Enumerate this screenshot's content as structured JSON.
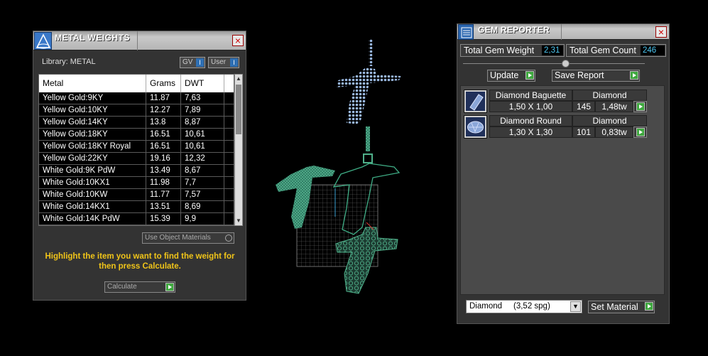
{
  "metal_weights": {
    "title": "METAL WEIGHTS",
    "library_label": "Library: METAL",
    "toggle_gv": "GV",
    "toggle_user": "User",
    "columns": [
      "Metal",
      "Grams",
      "DWT"
    ],
    "rows": [
      [
        "Yellow Gold:9KY",
        "11.87",
        "7,63"
      ],
      [
        "Yellow Gold:10KY",
        "12.27",
        "7,89"
      ],
      [
        "Yellow Gold:14KY",
        "13.8",
        "8,87"
      ],
      [
        "Yellow Gold:18KY",
        "16.51",
        "10,61"
      ],
      [
        "Yellow Gold:18KY Royal",
        "16.51",
        "10,61"
      ],
      [
        "Yellow Gold:22KY",
        "19.16",
        "12,32"
      ],
      [
        "White Gold:9K PdW",
        "13.49",
        "8,67"
      ],
      [
        "White Gold:10KX1",
        "11.98",
        "7,7"
      ],
      [
        "White Gold:10KW",
        "11.77",
        "7,57"
      ],
      [
        "White Gold:14KX1",
        "13.51",
        "8,69"
      ],
      [
        "White Gold:14K PdW",
        "15.39",
        "9,9"
      ]
    ],
    "use_object_materials": "Use Object Materials",
    "hint": "Highlight the item you want to find the weight for then press Calculate.",
    "calculate_label": "Calculate"
  },
  "gem_reporter": {
    "title": "GEM REPORTER",
    "total_weight_label": "Total Gem Weight",
    "total_weight_value": "2,31",
    "total_count_label": "Total Gem Count",
    "total_count_value": "246",
    "update_label": "Update",
    "save_report_label": "Save Report",
    "gems": [
      {
        "name": "Diamond Baguette",
        "material": "Diamond",
        "size": "1,50 X 1,00",
        "count": "145",
        "weight": "1,48tw",
        "icon": "baguette-gem-icon"
      },
      {
        "name": "Diamond Round",
        "material": "Diamond",
        "size": "1,30 X 1,30",
        "count": "101",
        "weight": "0,83tw",
        "icon": "round-gem-icon"
      }
    ],
    "material_select": "Diamond     (3,52 spg)",
    "set_material_label": "Set Material"
  },
  "colors": {
    "panel_bg": "#333333",
    "value_cyan": "#4cc6f0",
    "hint_yellow": "#f0c419",
    "go_green": "#3fa83f",
    "mesh_blue": "#9ab8e0",
    "mesh_green": "#3a9a7a"
  }
}
